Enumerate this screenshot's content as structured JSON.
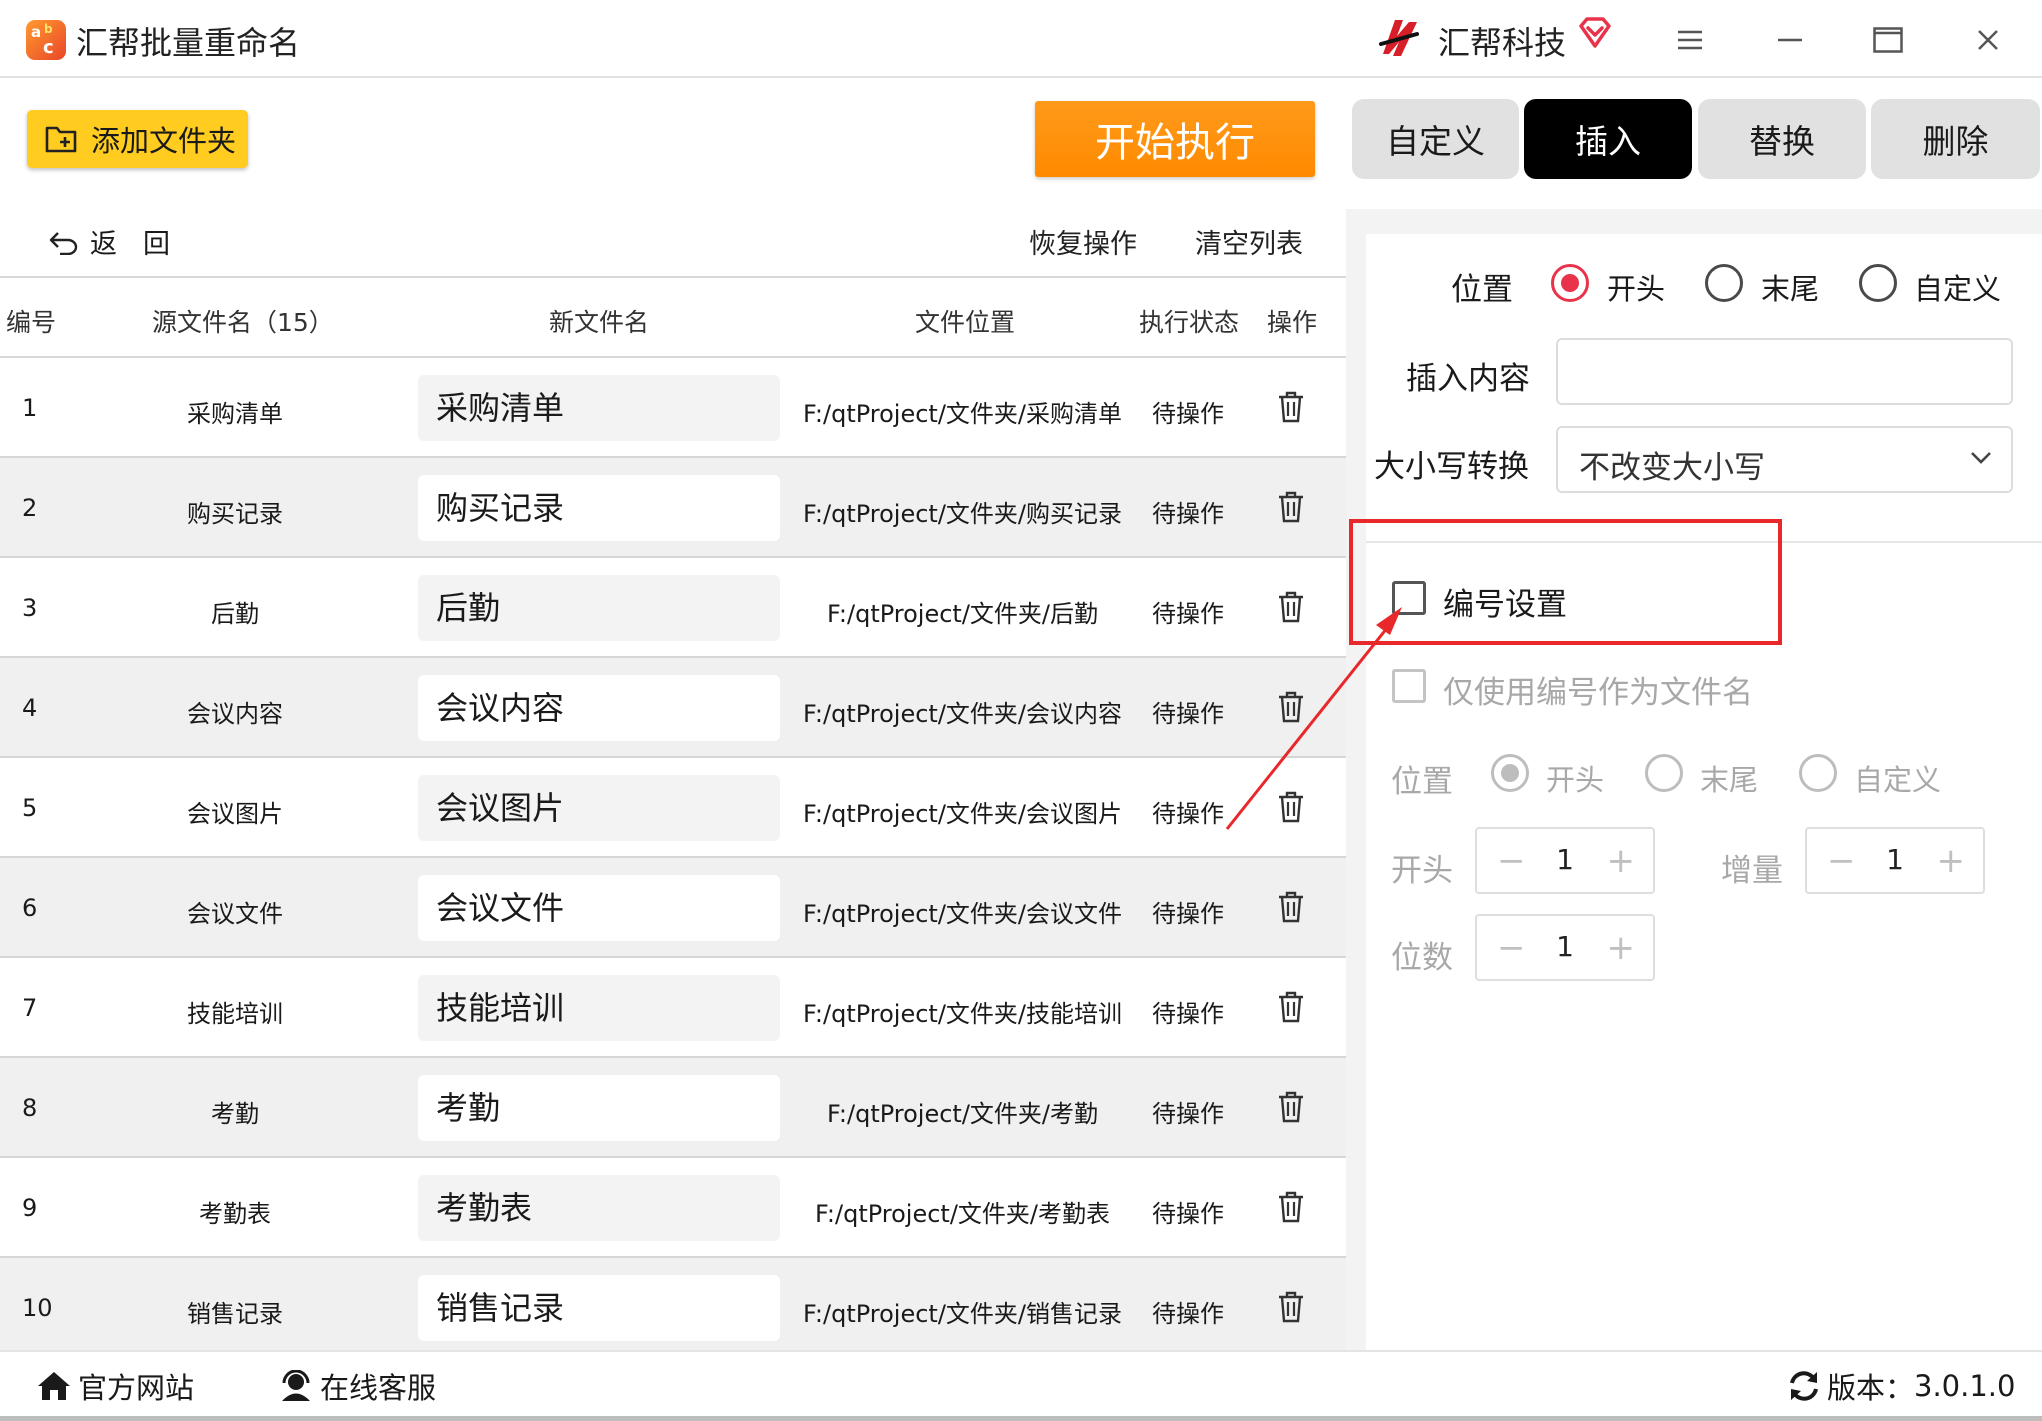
{
  "titlebar": {
    "app_title": "汇帮批量重命名",
    "brand_name": "汇帮科技"
  },
  "toolbar": {
    "add_folder_label": "添加文件夹",
    "start_label": "开始执行"
  },
  "tabs": [
    {
      "label": "自定义",
      "active": false
    },
    {
      "label": "插入",
      "active": true
    },
    {
      "label": "替换",
      "active": false
    },
    {
      "label": "删除",
      "active": false
    }
  ],
  "subbar": {
    "back_label": "返回",
    "restore_label": "恢复操作",
    "clear_label": "清空列表"
  },
  "table": {
    "headers": {
      "no": "编号",
      "source": "源文件名（15）",
      "new_name": "新文件名",
      "location": "文件位置",
      "status": "执行状态",
      "action": "操作"
    },
    "rows": [
      {
        "no": "1",
        "source": "采购清单",
        "new_name": "采购清单",
        "path": "F:/qtProject/文件夹/采购清单",
        "status": "待操作"
      },
      {
        "no": "2",
        "source": "购买记录",
        "new_name": "购买记录",
        "path": "F:/qtProject/文件夹/购买记录",
        "status": "待操作"
      },
      {
        "no": "3",
        "source": "后勤",
        "new_name": "后勤",
        "path": "F:/qtProject/文件夹/后勤",
        "status": "待操作"
      },
      {
        "no": "4",
        "source": "会议内容",
        "new_name": "会议内容",
        "path": "F:/qtProject/文件夹/会议内容",
        "status": "待操作"
      },
      {
        "no": "5",
        "source": "会议图片",
        "new_name": "会议图片",
        "path": "F:/qtProject/文件夹/会议图片",
        "status": "待操作"
      },
      {
        "no": "6",
        "source": "会议文件",
        "new_name": "会议文件",
        "path": "F:/qtProject/文件夹/会议文件",
        "status": "待操作"
      },
      {
        "no": "7",
        "source": "技能培训",
        "new_name": "技能培训",
        "path": "F:/qtProject/文件夹/技能培训",
        "status": "待操作"
      },
      {
        "no": "8",
        "source": "考勤",
        "new_name": "考勤",
        "path": "F:/qtProject/文件夹/考勤",
        "status": "待操作"
      },
      {
        "no": "9",
        "source": "考勤表",
        "new_name": "考勤表",
        "path": "F:/qtProject/文件夹/考勤表",
        "status": "待操作"
      },
      {
        "no": "10",
        "source": "销售记录",
        "new_name": "销售记录",
        "path": "F:/qtProject/文件夹/销售记录",
        "status": "待操作"
      }
    ]
  },
  "panel": {
    "position_label": "位置",
    "position_options": [
      "开头",
      "末尾",
      "自定义"
    ],
    "position_selected": "开头",
    "insert_content_label": "插入内容",
    "insert_content_value": "",
    "case_label": "大小写转换",
    "case_value": "不改变大小写",
    "numbering_label": "编号设置",
    "numbering_checked": false,
    "only_number_label": "仅使用编号作为文件名",
    "num_position_label": "位置",
    "num_position_options": [
      "开头",
      "末尾",
      "自定义"
    ],
    "start_label": "开头",
    "start_value": "1",
    "increment_label": "增量",
    "increment_value": "1",
    "digits_label": "位数",
    "digits_value": "1"
  },
  "footer": {
    "website_label": "官方网站",
    "service_label": "在线客服",
    "version_label": "版本：",
    "version_value": "3.0.1.0"
  },
  "colors": {
    "accent_red": "#e8334a",
    "start_orange": "#ff8a00",
    "add_yellow": "#ffcc1f",
    "active_tab": "#000000",
    "annotation_red": "#e8282a"
  }
}
